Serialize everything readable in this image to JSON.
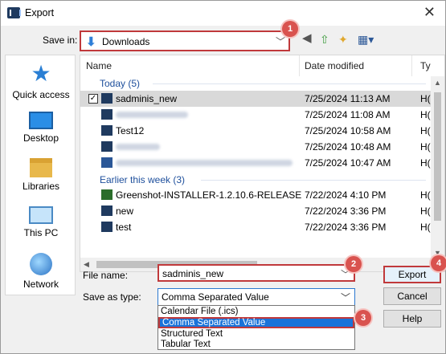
{
  "window": {
    "title": "Export",
    "close_glyph": "✕"
  },
  "toolbar": {
    "save_in_label": "Save in:",
    "location": "Downloads",
    "icons": [
      "back-icon",
      "up-folder-icon",
      "new-folder-icon",
      "view-menu-icon"
    ]
  },
  "places": [
    {
      "label": "Quick access",
      "icon": "quick-access-pin-icon"
    },
    {
      "label": "Desktop",
      "icon": "desktop-icon"
    },
    {
      "label": "Libraries",
      "icon": "libraries-folder-icon"
    },
    {
      "label": "This PC",
      "icon": "this-pc-icon"
    },
    {
      "label": "Network",
      "icon": "network-globe-icon"
    }
  ],
  "columns": {
    "name": "Name",
    "date": "Date modified",
    "type": "Ty"
  },
  "groups": [
    {
      "title": "Today (5)",
      "files": [
        {
          "name": "sadminis_new",
          "date": "7/25/2024 11:13 AM",
          "type": "H(",
          "selected": true,
          "icon": "app-file-icon"
        },
        {
          "name": "",
          "date": "7/25/2024 11:08 AM",
          "type": "H(",
          "icon": "app-file-icon",
          "redacted": true
        },
        {
          "name": "Test12",
          "date": "7/25/2024 10:58 AM",
          "type": "H(",
          "icon": "app-file-icon"
        },
        {
          "name": "",
          "date": "7/25/2024 10:48 AM",
          "type": "H(",
          "icon": "app-file-icon",
          "redacted": true
        },
        {
          "name": "",
          "date": "7/25/2024 10:47 AM",
          "type": "H(",
          "icon": "word-file-icon",
          "redacted": true
        }
      ]
    },
    {
      "title": "Earlier this week (3)",
      "files": [
        {
          "name": "Greenshot-INSTALLER-1.2.10.6-RELEASE",
          "date": "7/22/2024 4:10 PM",
          "type": "H(",
          "icon": "greenshot-file-icon"
        },
        {
          "name": "new",
          "date": "7/22/2024 3:36 PM",
          "type": "H(",
          "icon": "app-file-icon"
        },
        {
          "name": "test",
          "date": "7/22/2024 3:36 PM",
          "type": "H(",
          "icon": "app-file-icon"
        }
      ]
    }
  ],
  "form": {
    "file_name_label": "File name:",
    "file_name_value": "sadminis_new",
    "save_as_type_label": "Save as type:",
    "save_as_type_value": "Comma Separated Value",
    "type_options": [
      "Calendar File (.ics)",
      "Comma Separated Value",
      "Structured Text",
      "Tabular Text"
    ],
    "selected_option_index": 1
  },
  "buttons": {
    "export": "Export",
    "cancel": "Cancel",
    "help": "Help"
  },
  "callouts": [
    "1",
    "2",
    "3",
    "4"
  ],
  "colors": {
    "highlight_border": "#c0393b",
    "badge": "#d9534f",
    "selection": "#1a73d9"
  }
}
